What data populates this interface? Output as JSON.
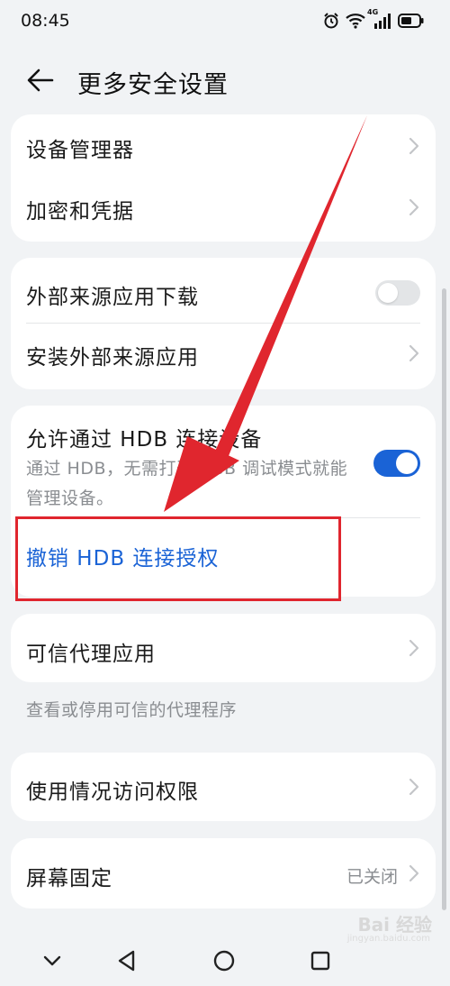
{
  "status_bar": {
    "time": "08:45",
    "icons": [
      "alarm-icon",
      "wifi-icon",
      "cellular-4g-icon",
      "battery-icon"
    ],
    "network_label": "4G"
  },
  "header": {
    "title": "更多安全设置",
    "back_icon": "arrow-left-icon"
  },
  "card_1": {
    "items": [
      {
        "label": "设备管理器"
      },
      {
        "label": "加密和凭据"
      }
    ]
  },
  "card_2": {
    "external_download": {
      "label": "外部来源应用下载",
      "toggle": "off"
    },
    "install_external": {
      "label": "安装外部来源应用"
    }
  },
  "card_3": {
    "hdb": {
      "label": "允许通过 HDB 连接设备",
      "description": "通过 HDB，无需打开 USB 调试模式就能管理设备。",
      "toggle": "on"
    },
    "revoke": {
      "label": "撤销 HDB 连接授权"
    }
  },
  "card_4": {
    "trust_agents": {
      "label": "可信代理应用"
    },
    "note": "查看或停用可信的代理程序"
  },
  "card_5": {
    "usage_access": {
      "label": "使用情况访问权限"
    }
  },
  "card_6": {
    "screen_pinning": {
      "label": "屏幕固定",
      "value": "已关闭"
    }
  },
  "watermark": {
    "text": "Bai 经验",
    "sub": "jingyan.baidu.com"
  },
  "colors": {
    "accent": "#1a63d6",
    "annotation_red": "#e0262e",
    "background": "#f1f3f5"
  },
  "nav_bar": {
    "icons": [
      "chevron-down-icon",
      "back-triangle-icon",
      "home-circle-icon",
      "recents-square-icon"
    ]
  }
}
